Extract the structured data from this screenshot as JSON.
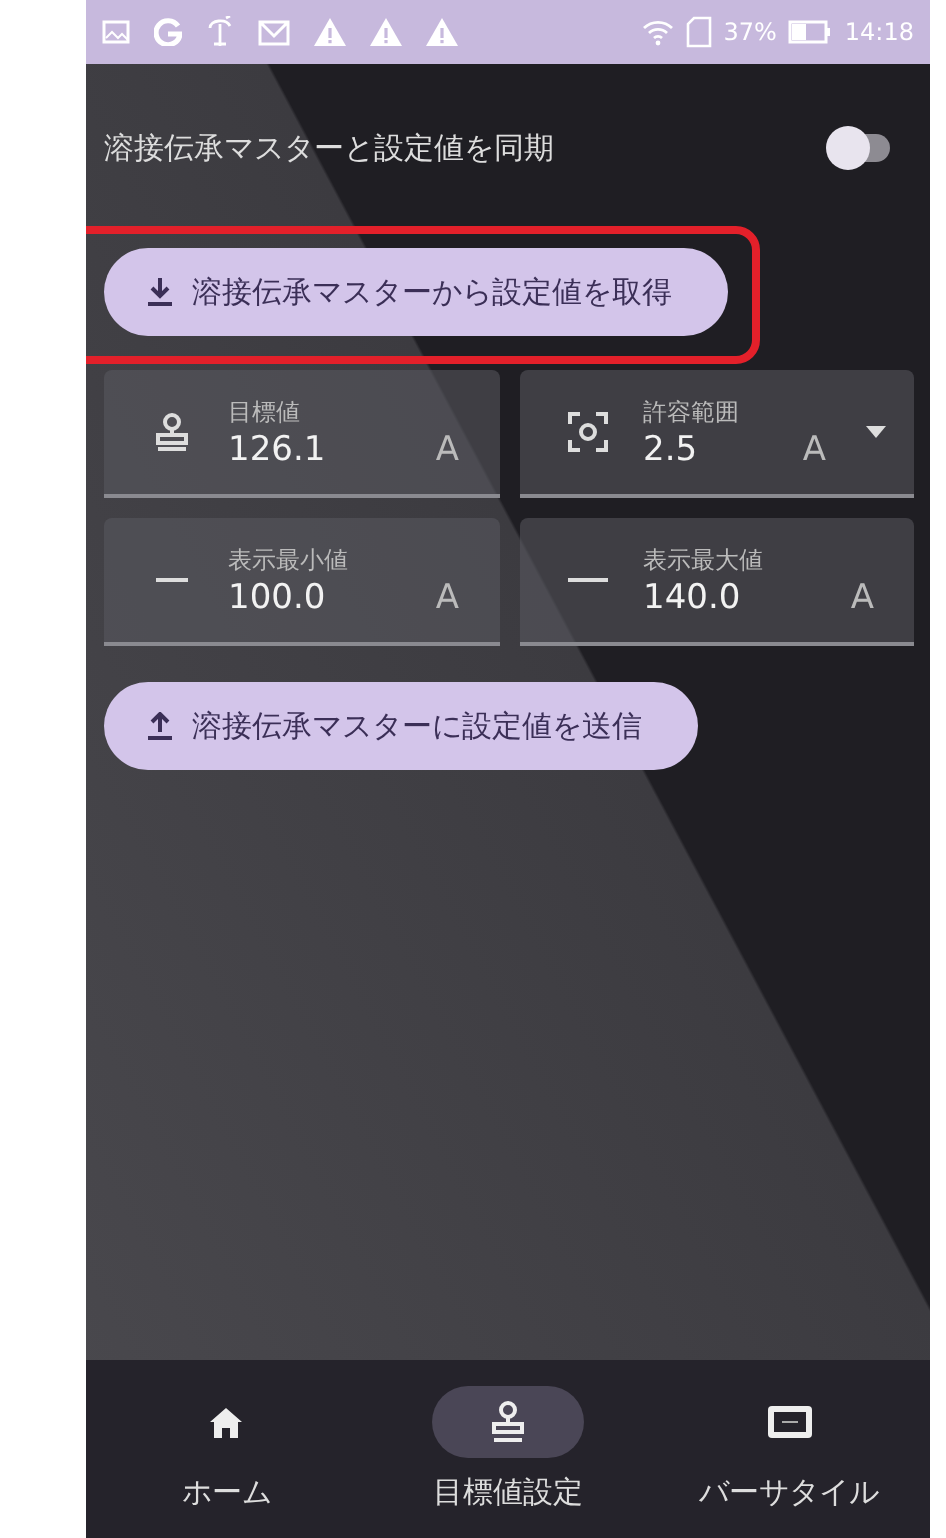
{
  "status_bar": {
    "storage": "37%",
    "time": "14:18"
  },
  "sync": {
    "label": "溶接伝承マスターと設定値を同期",
    "on": false
  },
  "fetch_button": {
    "label": "溶接伝承マスターから設定値を取得",
    "highlighted": true
  },
  "fields": [
    {
      "label": "目標値",
      "value": "126.1",
      "unit": "A",
      "dropdown": false
    },
    {
      "label": "許容範囲",
      "value": "2.5",
      "unit": "A",
      "dropdown": true
    },
    {
      "label": "表示最小値",
      "value": "100.0",
      "unit": "A",
      "dropdown": false
    },
    {
      "label": "表示最大値",
      "value": "140.0",
      "unit": "A",
      "dropdown": false
    }
  ],
  "send_button": {
    "label": "溶接伝承マスターに設定値を送信"
  },
  "nav": [
    {
      "label": "ホーム",
      "selected": false
    },
    {
      "label": "目標値設定",
      "selected": true
    },
    {
      "label": "バーサタイル",
      "selected": false
    }
  ]
}
